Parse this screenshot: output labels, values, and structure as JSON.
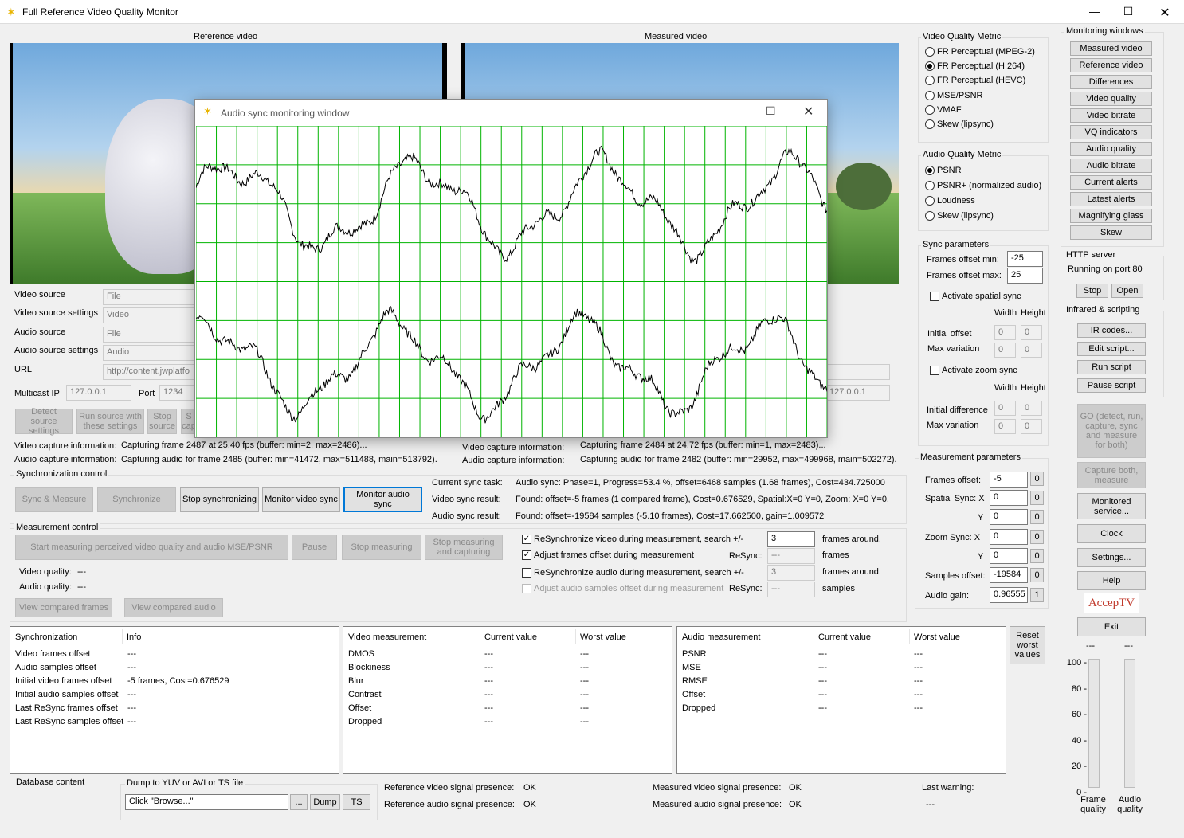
{
  "app": {
    "title": "Full Reference Video Quality Monitor",
    "logo": "AccepTV"
  },
  "video": {
    "reference_label": "Reference video",
    "measured_label": "Measured video"
  },
  "source": {
    "video_source_label": "Video source",
    "video_source": "File",
    "video_settings_label": "Video source settings",
    "video_settings": "Video",
    "audio_source_label": "Audio source",
    "audio_source": "File",
    "audio_settings_label": "Audio source settings",
    "audio_settings": "Audio",
    "url_label": "URL",
    "url": "http://content.jwplatfo",
    "multicast_label": "Multicast IP",
    "multicast": "127.0.0.1",
    "port_label": "Port",
    "port": "1234",
    "measured_multicast": "127.0.0.1",
    "detect_btn": "Detect source settings",
    "run_btn": "Run source with these settings",
    "stop_btn": "Stop source",
    "cap_btn": "S cap"
  },
  "capture": {
    "vci_label": "Video capture information:",
    "aci_label": "Audio capture information:",
    "ref_video": "Capturing frame 2487 at 25.40 fps (buffer: min=2, max=2486)...",
    "ref_audio": "Capturing audio for frame 2485 (buffer: min=41472, max=511488, main=513792).",
    "mea_video": "Capturing frame 2484 at 24.72 fps (buffer: min=1, max=2483)...",
    "mea_audio": "Capturing audio for frame 2482 (buffer: min=29952, max=499968, main=502272)."
  },
  "sync": {
    "group": "Synchronization control",
    "btn_sync_measure": "Sync & Measure",
    "btn_synchronize": "Synchronize",
    "btn_stop": "Stop synchronizing",
    "btn_monitor_video": "Monitor video sync",
    "btn_monitor_audio": "Monitor audio sync",
    "task_label": "Current sync task:",
    "task": "Audio sync: Phase=1, Progress=53.4 %, offset=6468 samples (1.68 frames), Cost=434.725000",
    "video_label": "Video sync result:",
    "video": "Found: offset=-5 frames (1 compared frame), Cost=0.676529, Spatial:X=0 Y=0, Zoom: X=0 Y=0, ",
    "audio_label": "Audio sync result:",
    "audio": "Found: offset=-19584 samples (-5.10 frames), Cost=17.662500, gain=1.009572"
  },
  "measure": {
    "group": "Measurement control",
    "btn_start": "Start measuring perceived video quality and audio MSE/PSNR",
    "btn_pause": "Pause",
    "btn_stop": "Stop measuring",
    "btn_stop_cap": "Stop measuring and capturing",
    "vq_label": "Video quality:",
    "vq": "---",
    "aq_label": "Audio quality:",
    "aq": "---",
    "btn_view_frames": "View compared frames",
    "btn_view_audio": "View compared audio",
    "resync_video": "ReSynchronize video during measurement, search +/-",
    "resync_video_val": "3",
    "frames_around": "frames around.",
    "adjust_frames": "Adjust frames offset during measurement",
    "resync_label": "ReSync:",
    "resync_frames_val": "---",
    "frames": "frames",
    "resync_audio": "ReSynchronize audio during measurement, search +/-",
    "resync_audio_val": "3",
    "frames_around2": "frames around.",
    "adjust_audio": "Adjust audio samples offset during measurement",
    "resync_label2": "ReSync:",
    "resync_samples_val": "---",
    "samples": "samples"
  },
  "tables": {
    "sync": {
      "headers": [
        "Synchronization",
        "Info"
      ],
      "rows": [
        [
          "Video frames offset",
          "---"
        ],
        [
          "Audio samples offset",
          "---"
        ],
        [
          "Initial video frames offset",
          "-5 frames, Cost=0.676529"
        ],
        [
          "Initial audio samples offset",
          "---"
        ],
        [
          "Last ReSync frames offset",
          "---"
        ],
        [
          "Last ReSync samples offset",
          "---"
        ]
      ]
    },
    "video": {
      "headers": [
        "Video measurement",
        "Current value",
        "Worst value"
      ],
      "rows": [
        [
          "DMOS",
          "---",
          "---"
        ],
        [
          "Blockiness",
          "---",
          "---"
        ],
        [
          "Blur",
          "---",
          "---"
        ],
        [
          "Contrast",
          "---",
          "---"
        ],
        [
          "Offset",
          "---",
          "---"
        ],
        [
          "Dropped",
          "---",
          "---"
        ]
      ]
    },
    "audio": {
      "headers": [
        "Audio measurement",
        "Current value",
        "Worst value"
      ],
      "rows": [
        [
          "PSNR",
          "---",
          "---"
        ],
        [
          "MSE",
          "---",
          "---"
        ],
        [
          "RMSE",
          "---",
          "---"
        ],
        [
          "Offset",
          "---",
          "---"
        ],
        [
          "Dropped",
          "---",
          "---"
        ]
      ]
    },
    "reset_btn": "Reset worst values"
  },
  "bottom": {
    "db_label": "Database content",
    "dump_label": "Dump to YUV or AVI or TS file",
    "dump_field": "Click \"Browse...\"",
    "browse": "...",
    "dump": "Dump",
    "ts": "TS",
    "ref_video_sig": "Reference video signal presence:",
    "ref_video_val": "OK",
    "ref_audio_sig": "Reference audio signal presence:",
    "ref_audio_val": "OK",
    "mea_video_sig": "Measured video signal presence:",
    "mea_video_val": "OK",
    "mea_audio_sig": "Measured audio signal presence:",
    "mea_audio_val": "OK",
    "last_warning_label": "Last warning:",
    "last_warning": "---"
  },
  "vqm": {
    "group": "Video Quality Metric",
    "options": [
      "FR Perceptual (MPEG-2)",
      "FR Perceptual (H.264)",
      "FR Perceptual (HEVC)",
      "MSE/PSNR",
      "VMAF",
      "Skew (lipsync)"
    ],
    "selected": 1
  },
  "aqm": {
    "group": "Audio Quality Metric",
    "options": [
      "PSNR",
      "PSNR+ (normalized audio)",
      "Loudness",
      "Skew (lipsync)"
    ],
    "selected": 0
  },
  "syncp": {
    "group": "Sync parameters",
    "min_label": "Frames offset min:",
    "min": "-25",
    "max_label": "Frames offset max:",
    "max": "25",
    "spatial": "Activate spatial sync",
    "width": "Width",
    "height": "Height",
    "init_offset": "Initial offset",
    "init_w": "0",
    "init_h": "0",
    "max_var": "Max variation",
    "mv_w": "0",
    "mv_h": "0",
    "zoom": "Activate zoom sync",
    "width2": "Width",
    "height2": "Height",
    "init_diff": "Initial difference",
    "id_w": "0",
    "id_h": "0",
    "max_var2": "Max variation",
    "mv2_w": "0",
    "mv2_h": "0"
  },
  "mp": {
    "group": "Measurement parameters",
    "frames_label": "Frames offset:",
    "frames": "-5",
    "frames_b": "0",
    "sx_label": "Spatial Sync: X",
    "sx": "0",
    "sx_b": "0",
    "sy_label": "Y",
    "sy": "0",
    "sy_b": "0",
    "zx_label": "Zoom Sync:  X",
    "zx": "0",
    "zx_b": "0",
    "zy_label": "Y",
    "zy": "0",
    "zy_b": "0",
    "samples_label": "Samples offset:",
    "samples": "-19584",
    "samples_b": "0",
    "gain_label": "Audio gain:",
    "gain": "0.96555",
    "gain_b": "1"
  },
  "monitoring": {
    "group": "Monitoring windows",
    "buttons": [
      "Measured video",
      "Reference video",
      "Differences",
      "Video quality",
      "Video bitrate",
      "VQ indicators",
      "Audio quality",
      "Audio bitrate",
      "Current alerts",
      "Latest alerts",
      "Magnifying glass",
      "Skew"
    ]
  },
  "http": {
    "group": "HTTP server",
    "status": "Running on port 80",
    "stop": "Stop",
    "open": "Open"
  },
  "ir": {
    "group": "Infrared & scripting",
    "buttons": [
      "IR codes...",
      "Edit script...",
      "Run script",
      "Pause script"
    ]
  },
  "right": {
    "go": "GO (detect, run, capture, sync and measure for both)",
    "capture_both": "Capture both, measure",
    "monitored": "Monitored service...",
    "clock": "Clock",
    "settings": "Settings...",
    "help": "Help",
    "exit": "Exit",
    "frame_top": "---",
    "audio_top": "---",
    "ticks": [
      "100 -",
      "80 -",
      "60 -",
      "40 -",
      "20 -",
      "0 -"
    ],
    "frame_label": "Frame quality",
    "audio_label": "Audio quality",
    "frame_level": 0,
    "audio_level": 0
  },
  "audio_window": {
    "title": "Audio sync monitoring window",
    "grid_color": "#00b400"
  }
}
